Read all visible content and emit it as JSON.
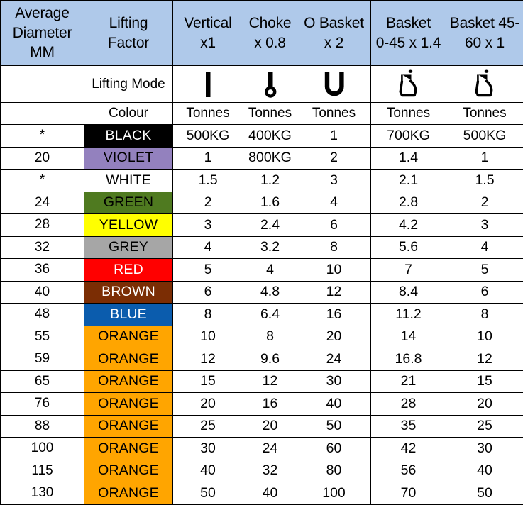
{
  "table": {
    "headers": [
      {
        "id": "average-diameter",
        "lines": [
          "Average",
          "Diameter",
          "MM"
        ]
      },
      {
        "id": "lifting-factor",
        "lines": [
          "Lifting",
          "Factor"
        ]
      },
      {
        "id": "vertical",
        "lines": [
          "Vertical",
          "x1"
        ]
      },
      {
        "id": "choke",
        "lines": [
          "Choke",
          "x 0.8"
        ]
      },
      {
        "id": "o-basket",
        "lines": [
          "O Basket",
          "x 2"
        ]
      },
      {
        "id": "basket-0-45",
        "lines": [
          "Basket",
          "0-45 x 1.4"
        ]
      },
      {
        "id": "basket-45-60",
        "lines": [
          "Basket 45-",
          "60 x 1"
        ]
      }
    ],
    "mode_row": {
      "label": "Lifting Mode",
      "icons": [
        "vertical-sling-icon",
        "choke-sling-icon",
        "o-basket-sling-icon",
        "basket-0-45-sling-icon",
        "basket-45-60-sling-icon"
      ]
    },
    "unit_row": {
      "label": "Colour",
      "units": [
        "Tonnes",
        "Tonnes",
        "Tonnes",
        "Tonnes",
        "Tonnes"
      ]
    },
    "rows": [
      {
        "diameter": "*",
        "colour": "BLACK",
        "bg": "#000000",
        "fg": "#FFFFFF",
        "values": [
          "500KG",
          "400KG",
          "1",
          "700KG",
          "500KG"
        ]
      },
      {
        "diameter": "20",
        "colour": "VIOLET",
        "bg": "#9381BE",
        "fg": "#000000",
        "values": [
          "1",
          "800KG",
          "2",
          "1.4",
          "1"
        ]
      },
      {
        "diameter": "*",
        "colour": "WHITE",
        "bg": "#FFFFFF",
        "fg": "#000000",
        "values": [
          "1.5",
          "1.2",
          "3",
          "2.1",
          "1.5"
        ]
      },
      {
        "diameter": "24",
        "colour": "GREEN",
        "bg": "#4F7A20",
        "fg": "#000000",
        "values": [
          "2",
          "1.6",
          "4",
          "2.8",
          "2"
        ]
      },
      {
        "diameter": "28",
        "colour": "YELLOW",
        "bg": "#FFFF00",
        "fg": "#000000",
        "values": [
          "3",
          "2.4",
          "6",
          "4.2",
          "3"
        ]
      },
      {
        "diameter": "32",
        "colour": "GREY",
        "bg": "#A6A6A6",
        "fg": "#000000",
        "values": [
          "4",
          "3.2",
          "8",
          "5.6",
          "4"
        ]
      },
      {
        "diameter": "36",
        "colour": "RED",
        "bg": "#FF0000",
        "fg": "#FFFFFF",
        "values": [
          "5",
          "4",
          "10",
          "7",
          "5"
        ]
      },
      {
        "diameter": "40",
        "colour": "BROWN",
        "bg": "#7B2D04",
        "fg": "#FFFFFF",
        "values": [
          "6",
          "4.8",
          "12",
          "8.4",
          "6"
        ]
      },
      {
        "diameter": "48",
        "colour": "BLUE",
        "bg": "#0B5CAD",
        "fg": "#FFFFFF",
        "values": [
          "8",
          "6.4",
          "16",
          "11.2",
          "8"
        ]
      },
      {
        "diameter": "55",
        "colour": "ORANGE",
        "bg": "#FFA500",
        "fg": "#000000",
        "values": [
          "10",
          "8",
          "20",
          "14",
          "10"
        ]
      },
      {
        "diameter": "59",
        "colour": "ORANGE",
        "bg": "#FFA500",
        "fg": "#000000",
        "values": [
          "12",
          "9.6",
          "24",
          "16.8",
          "12"
        ]
      },
      {
        "diameter": "65",
        "colour": "ORANGE",
        "bg": "#FFA500",
        "fg": "#000000",
        "values": [
          "15",
          "12",
          "30",
          "21",
          "15"
        ]
      },
      {
        "diameter": "76",
        "colour": "ORANGE",
        "bg": "#FFA500",
        "fg": "#000000",
        "values": [
          "20",
          "16",
          "40",
          "28",
          "20"
        ]
      },
      {
        "diameter": "88",
        "colour": "ORANGE",
        "bg": "#FFA500",
        "fg": "#000000",
        "values": [
          "25",
          "20",
          "50",
          "35",
          "25"
        ]
      },
      {
        "diameter": "100",
        "colour": "ORANGE",
        "bg": "#FFA500",
        "fg": "#000000",
        "values": [
          "30",
          "24",
          "60",
          "42",
          "30"
        ]
      },
      {
        "diameter": "115",
        "colour": "ORANGE",
        "bg": "#FFA500",
        "fg": "#000000",
        "values": [
          "40",
          "32",
          "80",
          "56",
          "40"
        ]
      },
      {
        "diameter": "130",
        "colour": "ORANGE",
        "bg": "#FFA500",
        "fg": "#000000",
        "values": [
          "50",
          "40",
          "100",
          "70",
          "50"
        ]
      }
    ],
    "colors": {
      "header_bg": "#AFC9EA",
      "border": "#000000",
      "page_bg": "#FFFFFF"
    }
  }
}
